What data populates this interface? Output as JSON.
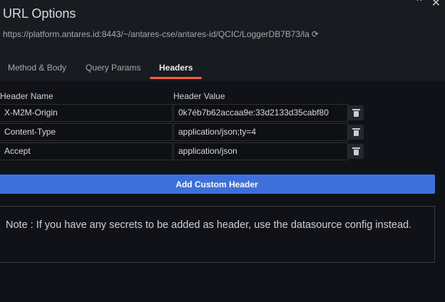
{
  "window": {
    "title": "URL Options",
    "collapse_icon": "chevron-up-icon",
    "close_icon": "close-icon"
  },
  "url": {
    "text": "https://platform.antares.id:8443/~/antares-cse/antares-id/QCIC/LoggerDB7B73/la",
    "refresh_icon": "refresh-icon"
  },
  "tabs": [
    {
      "label": "Method & Body",
      "active": false
    },
    {
      "label": "Query Params",
      "active": false
    },
    {
      "label": "Headers",
      "active": true
    }
  ],
  "headers_table": {
    "columns": [
      "Header Name",
      "Header Value"
    ],
    "rows": [
      {
        "name": "X-M2M-Origin",
        "value": "0k7éb7b62accaa9e:33d2133d35cabf80"
      },
      {
        "name": "Content-Type",
        "value": "application/json;ty=4"
      },
      {
        "name": "Accept",
        "value": "application/json"
      }
    ]
  },
  "add_button_label": "Add Custom Header",
  "note": "Note : If you have any secrets to be added as header, use the datasource config instead.",
  "colors": {
    "accent_tab": "#f55f3e",
    "primary_button": "#3d71d9",
    "background": "#111217"
  }
}
